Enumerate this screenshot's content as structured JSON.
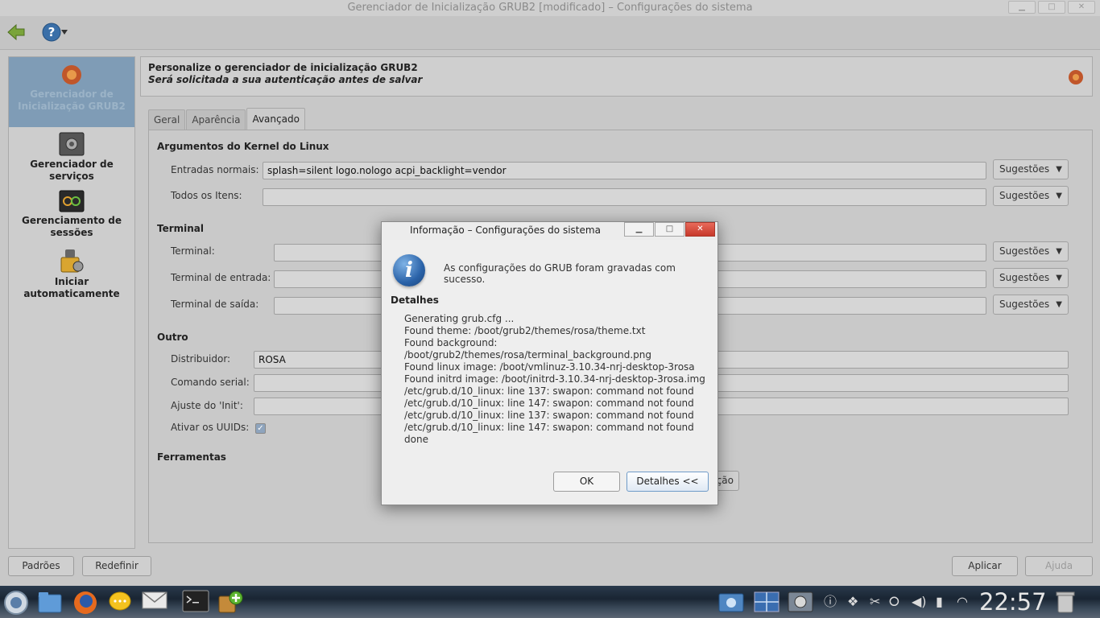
{
  "window": {
    "title": "Gerenciador de Inicialização GRUB2 [modificado] – Configurações do sistema",
    "min_glyph": "▁",
    "max_glyph": "□",
    "close_glyph": "✕"
  },
  "sidebar": {
    "items": [
      {
        "label": "Gerenciador de Inicialização GRUB2",
        "active": true
      },
      {
        "label": "Gerenciador de serviços"
      },
      {
        "label": "Gerenciamento de sessões"
      },
      {
        "label": "Iniciar automaticamente"
      }
    ]
  },
  "header": {
    "title": "Personalize o gerenciador de inicialização GRUB2",
    "subtitle": "Será solicitada a sua autenticação antes de salvar"
  },
  "tabs": [
    "Geral",
    "Aparência",
    "Avançado"
  ],
  "kernel": {
    "section": "Argumentos do Kernel do Linux",
    "normal_label": "Entradas normais:",
    "normal_value": "splash=silent logo.nologo acpi_backlight=vendor",
    "all_label": "Todos os Itens:",
    "all_value": ""
  },
  "terminal": {
    "section": "Terminal",
    "terminal_label": "Terminal:",
    "input_label": "Terminal de entrada:",
    "output_label": "Terminal de saída:"
  },
  "other": {
    "section": "Outro",
    "distributor_label": "Distribuidor:",
    "distributor_value": "ROSA",
    "serial_label": "Comando serial:",
    "init_label": "Ajuste do 'Init':",
    "uuid_label": "Ativar os UUIDs:",
    "uuid_check": "✓"
  },
  "tools": {
    "section": "Ferramentas",
    "hidden_btn_tail": "ção"
  },
  "suggest_label": "Sugestões",
  "suggest_arrow": "▼",
  "bottom": {
    "defaults": "Padrões",
    "reset": "Redefinir",
    "apply": "Aplicar",
    "help": "Ajuda"
  },
  "dialog": {
    "title": "Informação – Configurações do sistema",
    "message": "As configurações do GRUB foram gravadas com sucesso.",
    "details_title": "Detalhes",
    "log": [
      "Generating grub.cfg ...",
      "Found theme: /boot/grub2/themes/rosa/theme.txt",
      "Found background:",
      "/boot/grub2/themes/rosa/terminal_background.png",
      "Found linux image: /boot/vmlinuz-3.10.34-nrj-desktop-3rosa",
      "Found initrd image: /boot/initrd-3.10.34-nrj-desktop-3rosa.img",
      "/etc/grub.d/10_linux: line 137: swapon: command not found",
      "/etc/grub.d/10_linux: line 147: swapon: command not found",
      "/etc/grub.d/10_linux: line 137: swapon: command not found",
      "/etc/grub.d/10_linux: line 147: swapon: command not found",
      "done"
    ],
    "ok": "OK",
    "details_btn": "Detalhes <<",
    "info_glyph": "i"
  },
  "taskbar": {
    "clock": "22:57"
  }
}
